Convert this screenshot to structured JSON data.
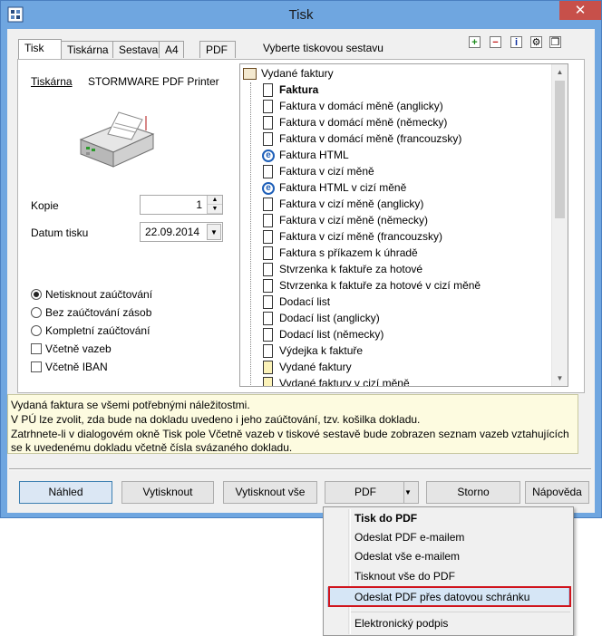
{
  "window": {
    "title": "Tisk",
    "close_glyph": "✕"
  },
  "tabs": [
    {
      "label": "Tisk",
      "active": true
    },
    {
      "label": "Tiskárna",
      "active": false
    },
    {
      "label": "Sestava",
      "active": false
    },
    {
      "label": "A4",
      "active": false
    },
    {
      "label": "PDF",
      "active": false
    }
  ],
  "tab_hint": "Vyberte tiskovou sestavu",
  "toolbar_icons": [
    "add-icon",
    "remove-icon",
    "info-icon",
    "settings-icon",
    "copy-icon"
  ],
  "printer": {
    "label": "Tiskárna",
    "name": "STORMWARE PDF Printer"
  },
  "copies": {
    "label": "Kopie",
    "value": "1"
  },
  "print_date": {
    "label": "Datum tisku",
    "value": "22.09.2014"
  },
  "options": {
    "radios": [
      {
        "label": "Netisknout zaúčtování",
        "selected": true
      },
      {
        "label": "Bez zaúčtování zásob",
        "selected": false
      },
      {
        "label": "Kompletní zaúčtování",
        "selected": false
      }
    ],
    "checks": [
      {
        "label": "Včetně vazeb",
        "checked": false
      },
      {
        "label": "Včetně IBAN",
        "checked": false
      }
    ]
  },
  "report_tree": {
    "root": "Vydané faktury",
    "items": [
      {
        "label": "Faktura",
        "icon": "doc",
        "bold": true
      },
      {
        "label": "Faktura v domácí měně (anglicky)",
        "icon": "doc"
      },
      {
        "label": "Faktura v domácí měně (německy)",
        "icon": "doc"
      },
      {
        "label": "Faktura v domácí měně (francouzsky)",
        "icon": "doc"
      },
      {
        "label": "Faktura HTML",
        "icon": "ie"
      },
      {
        "label": "Faktura v cizí měně",
        "icon": "doc"
      },
      {
        "label": "Faktura HTML v cizí měně",
        "icon": "ie"
      },
      {
        "label": "Faktura v cizí měně (anglicky)",
        "icon": "doc"
      },
      {
        "label": "Faktura v cizí měně (německy)",
        "icon": "doc"
      },
      {
        "label": "Faktura v cizí měně (francouzsky)",
        "icon": "doc"
      },
      {
        "label": "Faktura s příkazem k úhradě",
        "icon": "doc"
      },
      {
        "label": "Stvrzenka k faktuře za hotové",
        "icon": "doc"
      },
      {
        "label": "Stvrzenka k faktuře za hotové v cizí měně",
        "icon": "doc"
      },
      {
        "label": "Dodací list",
        "icon": "doc"
      },
      {
        "label": "Dodací list (anglicky)",
        "icon": "doc"
      },
      {
        "label": "Dodací list (německy)",
        "icon": "doc"
      },
      {
        "label": "Výdejka k faktuře",
        "icon": "doc"
      },
      {
        "label": "Vydané faktury",
        "icon": "doc-yellow"
      },
      {
        "label": "Vydané faktury v cizí měně",
        "icon": "doc-yellow"
      }
    ]
  },
  "help_text": [
    "Vydaná faktura se všemi potřebnými náležitostmi.",
    "V PÚ lze zvolit, zda bude na dokladu uvedeno i jeho zaúčtování, tzv. košilka dokladu.",
    "Zatrhnete-li v dialogovém okně Tisk pole Včetně vazeb v tiskové sestavě bude zobrazen seznam vazeb vztahujících",
    "se k uvedenému dokladu včetně čísla svázaného dokladu."
  ],
  "buttons": {
    "preview": "Náhled",
    "print": "Vytisknout",
    "print_all": "Vytisknout vše",
    "pdf": "PDF",
    "cancel": "Storno",
    "help": "Nápověda"
  },
  "pdf_menu": [
    {
      "label": "Tisk do PDF",
      "bold": true
    },
    {
      "label": "Odeslat PDF e-mailem"
    },
    {
      "label": "Odeslat vše e-mailem"
    },
    {
      "label": "Tisknout vše do PDF"
    },
    {
      "label": "Odeslat PDF přes datovou schránku",
      "highlighted": true
    },
    {
      "label": "Elektronický podpis"
    }
  ],
  "colors": {
    "title_bar": "#6fa6e0",
    "close": "#c7504a",
    "highlight_frame": "#d0141c",
    "help_bg": "#fdfbe0"
  }
}
